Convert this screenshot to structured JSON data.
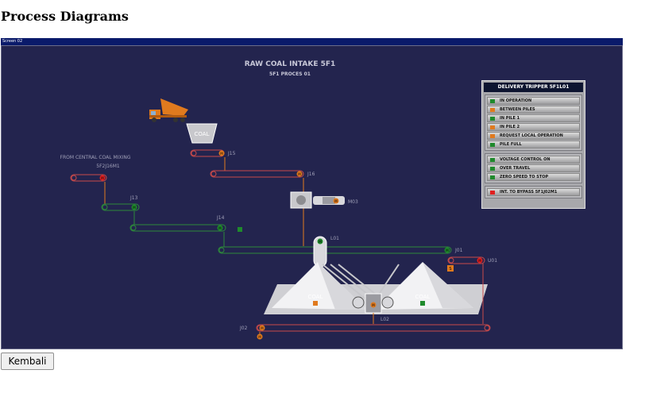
{
  "page_title": "Process Diagrams",
  "screen_label": "Screen 02",
  "diagram": {
    "title": "RAW COAL INTAKE 5F1",
    "subtitle": "5F1 PROCES 01",
    "source_label_1": "FROM CENTRAL COAL MIXING",
    "source_label_2": "5F2J16M1",
    "hopper_label": "COAL",
    "pile_left_label": "COAL",
    "pile_right_label": "COAL",
    "conveyors": {
      "j15": "J15",
      "j16": "J16",
      "j13": "J13",
      "j14": "J14",
      "j01": "J01",
      "j02": "J02",
      "u01": "U01",
      "l01": "L01",
      "l02": "L02",
      "m03": "M03"
    },
    "motor_label": "M",
    "s_label": "S"
  },
  "status_panel": {
    "title": "DELIVERY TRIPPER 5F1L01",
    "group1": [
      {
        "label": "IN OPERATION",
        "color": "#1f8a2c"
      },
      {
        "label": "BETWEEN PILES",
        "color": "#e07a1e"
      },
      {
        "label": "IN PILE 1",
        "color": "#1f8a2c"
      },
      {
        "label": "IN PILE 2",
        "color": "#e07a1e"
      },
      {
        "label": "REQUEST LOCAL OPERATION",
        "color": "#e07a1e"
      },
      {
        "label": "PILE FULL",
        "color": "#1f8a2c"
      }
    ],
    "group2": [
      {
        "label": "VOLTAGE CONTROL ON",
        "color": "#1f8a2c"
      },
      {
        "label": "OVER TRAVEL",
        "color": "#1f8a2c"
      },
      {
        "label": "ZERO SPEED TO STOP",
        "color": "#1f8a2c"
      }
    ],
    "group3": [
      {
        "label": "INT. TO BYPASS 5F1J02M1",
        "color": "#e02020"
      }
    ]
  },
  "back_button": "Kembali",
  "colors": {
    "background": "#23244e",
    "running": "#1f8a2c",
    "stopped": "#e07a1e",
    "fault": "#e02020"
  }
}
